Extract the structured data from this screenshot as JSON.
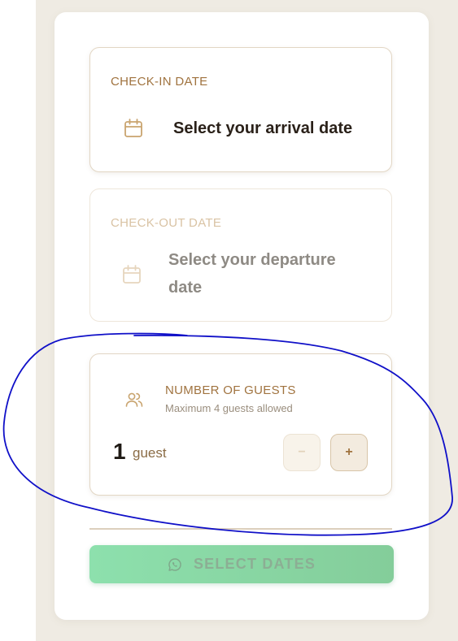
{
  "booking": {
    "checkin": {
      "label": "CHECK-IN DATE",
      "value": "Select your arrival date"
    },
    "checkout": {
      "label": "CHECK-OUT DATE",
      "value": "Select your departure date"
    },
    "guests": {
      "title": "NUMBER OF GUESTS",
      "subtitle": "Maximum 4 guests allowed",
      "count": "1",
      "unit": "guest",
      "minus_label": "−",
      "plus_label": "+"
    },
    "submit": {
      "label": "SELECT DATES",
      "icon": "whatsapp-icon"
    }
  },
  "icons": {
    "calendar": "calendar-icon",
    "guests": "users-icon"
  },
  "colors": {
    "accent": "#a0733f",
    "background": "#efebe3",
    "button_green": "#8de0ad",
    "annotation_stroke": "#1010c8"
  }
}
